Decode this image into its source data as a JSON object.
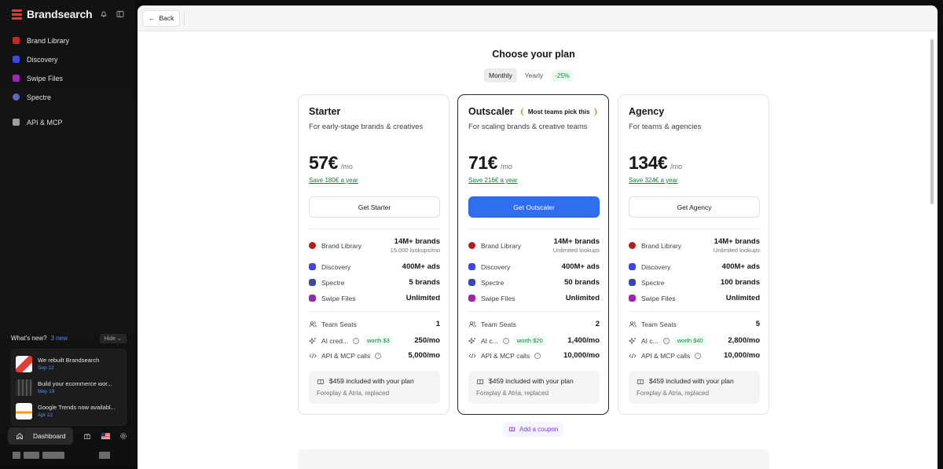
{
  "sidebar": {
    "brand": "Brandsearch",
    "nav": [
      {
        "label": "Brand Library",
        "color": "#d32f2f"
      },
      {
        "label": "Discovery",
        "color": "#3b49df"
      },
      {
        "label": "Swipe Files",
        "color": "#9c27b0"
      },
      {
        "label": "Spectre",
        "color": "#5c6bc0"
      },
      {
        "label": "API & MCP",
        "color": "#9e9e9e"
      }
    ],
    "whats_new": {
      "title": "What's new?",
      "count": "3 new",
      "hide": "Hide",
      "items": [
        {
          "title": "We rebuilt Brandsearch",
          "date": "Sep 12"
        },
        {
          "title": "Build your ecommerce wor...",
          "date": "May 19"
        },
        {
          "title": "Google Trends now availabl...",
          "date": "Apr 12"
        }
      ]
    },
    "dashboard": "Dashboard"
  },
  "topbar": {
    "back": "Back"
  },
  "page": {
    "title": "Choose your plan",
    "billing": {
      "monthly": "Monthly",
      "yearly": "Yearly",
      "discount": "-25%"
    },
    "coupon": "Add a coupon"
  },
  "plans": [
    {
      "name": "Starter",
      "badge": "",
      "desc": "For early-stage brands & creatives",
      "price": "57€",
      "per": "/mo",
      "save": "Save 180€ a year",
      "cta": "Get Starter",
      "brand_library": "14M+ brands",
      "brand_library_sub": "15,000 lookups/mo",
      "discovery": "400M+ ads",
      "spectre": "5 brands",
      "swipe": "Unlimited",
      "seats": "1",
      "ai_label": "AI cred...",
      "ai_worth": "worth $3",
      "ai_value": "250/mo",
      "api_value": "5,000/mo"
    },
    {
      "name": "Outscaler",
      "badge": "Most teams pick this",
      "desc": "For scaling brands & creative teams",
      "price": "71€",
      "per": "/mo",
      "save": "Save 216€ a year",
      "cta": "Get Outscaler",
      "brand_library": "14M+ brands",
      "brand_library_sub": "Unlimited lookups",
      "discovery": "400M+ ads",
      "spectre": "50 brands",
      "swipe": "Unlimited",
      "seats": "2",
      "ai_label": "AI c...",
      "ai_worth": "worth $20",
      "ai_value": "1,400/mo",
      "api_value": "10,000/mo"
    },
    {
      "name": "Agency",
      "badge": "",
      "desc": "For teams & agencies",
      "price": "134€",
      "per": "/mo",
      "save": "Save 324€ a year",
      "cta": "Get Agency",
      "brand_library": "14M+ brands",
      "brand_library_sub": "Unlimited lookups",
      "discovery": "400M+ ads",
      "spectre": "100 brands",
      "swipe": "Unlimited",
      "seats": "5",
      "ai_label": "AI c...",
      "ai_worth": "worth $40",
      "ai_value": "2,800/mo",
      "api_value": "10,000/mo"
    }
  ],
  "feature_labels": {
    "brand_library": "Brand Library",
    "discovery": "Discovery",
    "spectre": "Spectre",
    "swipe": "Swipe Files",
    "seats": "Team Seats",
    "api": "API & MCP calls"
  },
  "included": {
    "line1": "$459 included with your plan",
    "line2": "Foreplay & Atria, replaced"
  },
  "colors": {
    "accent": "#2f6fef",
    "success": "#16803c",
    "coupon": "#7c3aed"
  }
}
